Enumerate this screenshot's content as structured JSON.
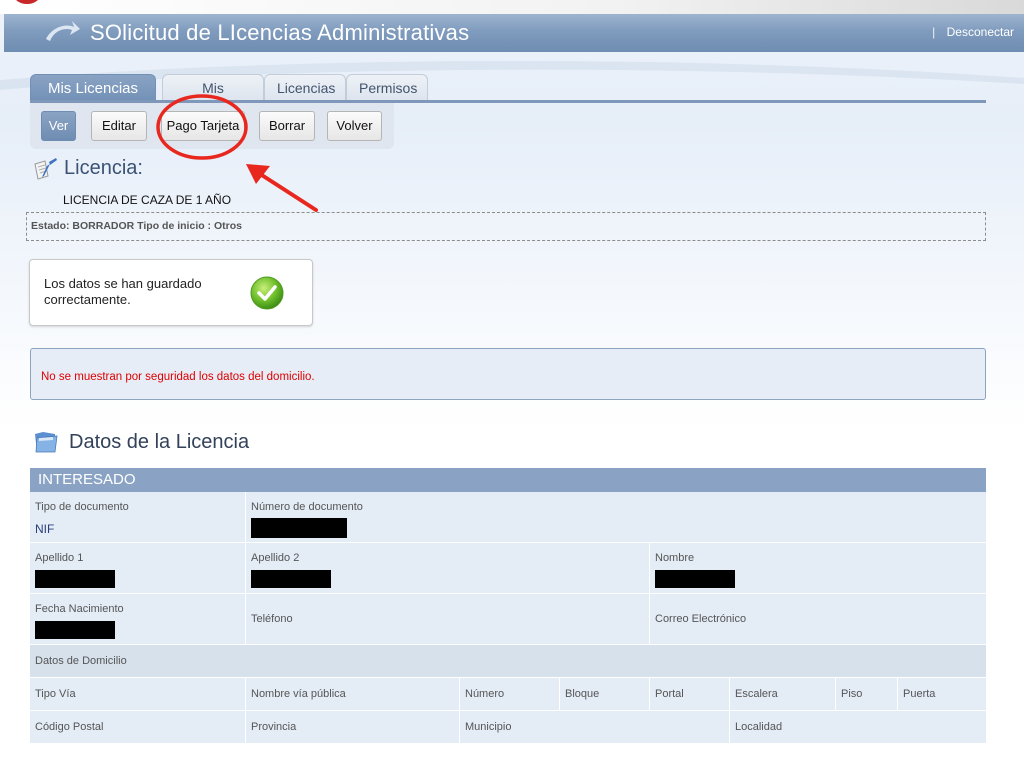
{
  "header": {
    "title": "SOlicitud de LIcencias Administrativas",
    "logout_label": "Desconectar",
    "separator": "|"
  },
  "tabs": [
    {
      "label": "Mis Licencias",
      "active": true
    },
    {
      "label": "Mis Permisos",
      "active": false
    },
    {
      "label": "Licencias",
      "active": false
    },
    {
      "label": "Permisos",
      "active": false
    }
  ],
  "toolbar": {
    "buttons": [
      {
        "label": "Ver",
        "selected": true
      },
      {
        "label": "Editar",
        "selected": false
      },
      {
        "label": "Pago Tarjeta",
        "selected": false
      },
      {
        "label": "Borrar",
        "selected": false
      },
      {
        "label": "Volver",
        "selected": false
      }
    ]
  },
  "licence": {
    "heading": "Licencia:",
    "name": "LICENCIA DE CAZA DE 1 AÑO",
    "status_line": "Estado: BORRADOR Tipo de inicio : Otros"
  },
  "message": {
    "text": "Los datos se han guardado correctamente.",
    "icon": "check-circle-icon"
  },
  "warning": {
    "text": "No se muestran por seguridad los datos del domicilio."
  },
  "data_section": {
    "heading": "Datos de la Licencia",
    "group_title": "INTERESADO",
    "fields": {
      "tipo_documento": {
        "label": "Tipo de documento",
        "value": "NIF"
      },
      "numero_documento": {
        "label": "Número de documento"
      },
      "apellido1": {
        "label": "Apellido 1"
      },
      "apellido2": {
        "label": "Apellido 2"
      },
      "nombre": {
        "label": "Nombre"
      },
      "fecha_nacimiento": {
        "label": "Fecha Nacimiento"
      },
      "telefono": {
        "label": "Teléfono"
      },
      "correo": {
        "label": "Correo Electrónico"
      },
      "domicilio": {
        "label": "Datos de Domicilio"
      },
      "tipo_via": {
        "label": "Tipo Vía"
      },
      "nombre_via": {
        "label": "Nombre vía pública"
      },
      "numero": {
        "label": "Número"
      },
      "bloque": {
        "label": "Bloque"
      },
      "portal": {
        "label": "Portal"
      },
      "escalera": {
        "label": "Escalera"
      },
      "piso": {
        "label": "Piso"
      },
      "puerta": {
        "label": "Puerta"
      },
      "codigo_postal": {
        "label": "Código Postal"
      },
      "provincia": {
        "label": "Provincia"
      },
      "municipio": {
        "label": "Municipio"
      },
      "localidad": {
        "label": "Localidad"
      }
    }
  },
  "colors": {
    "header": "#7f9bbd",
    "tab_active": "#7f98ba",
    "warning_text": "#e00000",
    "annotation": "#e8281e"
  }
}
